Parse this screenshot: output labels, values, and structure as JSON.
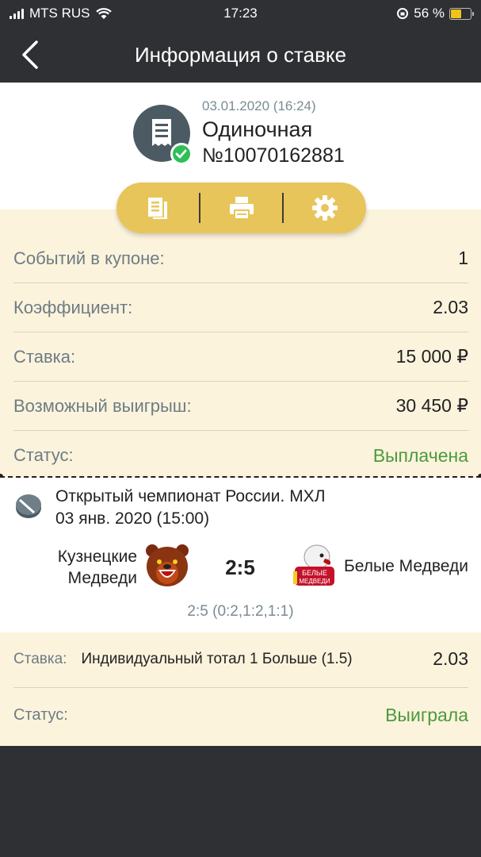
{
  "status_bar": {
    "carrier": "MTS RUS",
    "time": "17:23",
    "battery_percent": "56 %",
    "battery_level": 0.56
  },
  "nav": {
    "title": "Информация о ставке",
    "back_icon": "chevron-left-icon"
  },
  "header": {
    "date": "03.01.2020 (16:24)",
    "type": "Одиночная",
    "number": "№10070162881",
    "icon": "receipt-icon",
    "badge_icon": "check-icon",
    "badge_color": "#2fbf57"
  },
  "actions": [
    {
      "name": "copy-icon"
    },
    {
      "name": "print-icon"
    },
    {
      "name": "settings-icon"
    }
  ],
  "summary": {
    "events_label": "Событий в купоне:",
    "events_value": "1",
    "coef_label": "Коэффициент:",
    "coef_value": "2.03",
    "stake_label": "Ставка:",
    "stake_value": "15 000 ₽",
    "win_label": "Возможный выигрыш:",
    "win_value": "30 450 ₽",
    "status_label": "Статус:",
    "status_value": "Выплачена",
    "status_color": "#4c9a3c"
  },
  "event": {
    "championship": "Открытый чемпионат России. МХЛ",
    "date": "03 янв. 2020 (15:00)",
    "home_team": "Кузнецкие Медведи",
    "away_team": "Белые Медведи",
    "score": "2:5",
    "period_score": "2:5 (0:2,1:2,1:1)",
    "sport_icon": "hockey-puck-icon"
  },
  "bet": {
    "stake_label": "Ставка:",
    "description": "Индивидуальный тотал 1 Больше (1.5)",
    "odds": "2.03",
    "status_label": "Статус:",
    "status_value": "Выиграла"
  },
  "colors": {
    "dark_bg": "#2e3033",
    "accent_yellow": "#e8c55a",
    "cream_bg": "#fcf3dc",
    "green": "#4c9a3c"
  }
}
